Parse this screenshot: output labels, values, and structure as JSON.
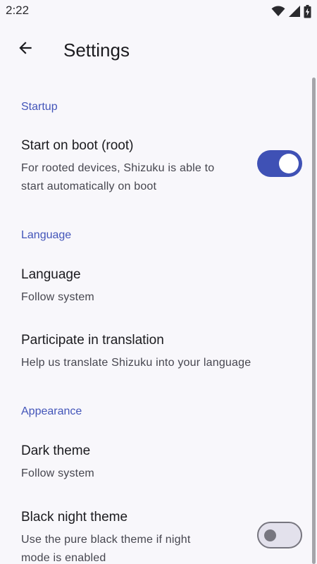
{
  "status_bar": {
    "time": "2:22",
    "icons": [
      "wifi-icon",
      "signal-icon",
      "battery-icon"
    ]
  },
  "app_bar": {
    "back_icon": "arrow-back-icon",
    "title": "Settings"
  },
  "sections": {
    "startup": {
      "header": "Startup",
      "start_on_boot": {
        "title": "Start on boot (root)",
        "summary_line1": "For rooted devices, Shizuku is able to",
        "summary_line2": "start automatically on boot",
        "enabled": true
      }
    },
    "language": {
      "header": "Language",
      "language_item": {
        "title": "Language",
        "summary": "Follow system"
      },
      "translation_item": {
        "title": "Participate in translation",
        "summary": "Help us translate Shizuku into your language"
      }
    },
    "appearance": {
      "header": "Appearance",
      "dark_theme": {
        "title": "Dark theme",
        "summary": "Follow system"
      },
      "black_night_theme": {
        "title": "Black night theme",
        "summary_line1": "Use the pure black theme if night",
        "summary_line2": "mode is enabled",
        "enabled": false
      }
    }
  },
  "colors": {
    "accent": "#3f51b5",
    "section_header": "#4355b9",
    "background": "#f8f7fb"
  }
}
